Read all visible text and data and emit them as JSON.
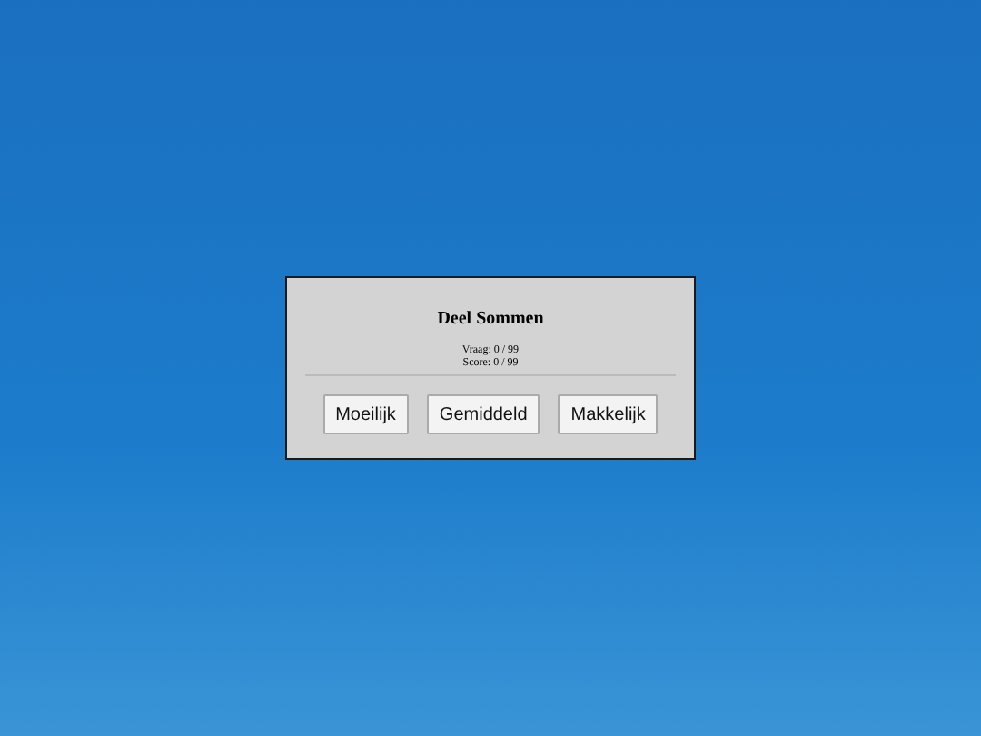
{
  "dialog": {
    "title": "Deel Sommen",
    "stats": [
      "Vraag: 0 / 99",
      "Score: 0 / 99"
    ],
    "buttons": [
      "Moeilijk",
      "Gemiddeld",
      "Makkelijk"
    ]
  }
}
